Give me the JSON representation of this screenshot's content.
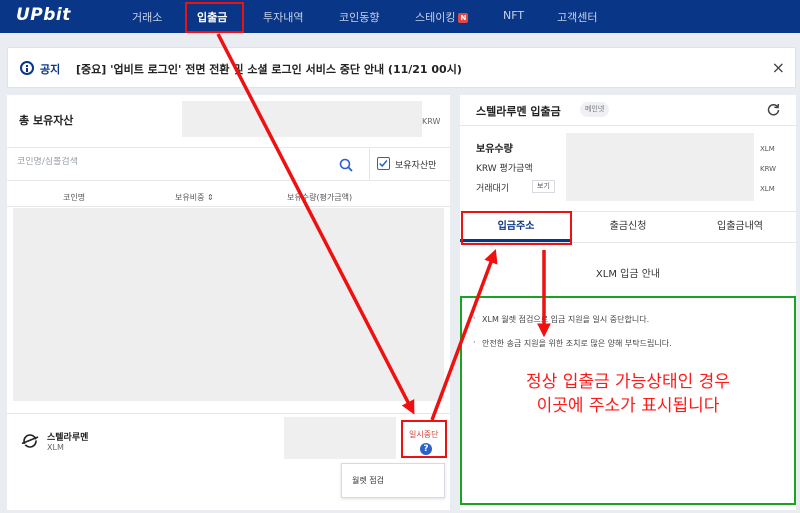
{
  "nav": {
    "logo": "UPbit",
    "items": [
      {
        "label": "거래소"
      },
      {
        "label": "입출금"
      },
      {
        "label": "투자내역"
      },
      {
        "label": "코인동향"
      },
      {
        "label": "스테이킹",
        "badge": "N"
      },
      {
        "label": "NFT"
      },
      {
        "label": "고객센터"
      }
    ],
    "active": "입출금"
  },
  "notice": {
    "label": "공지",
    "text": "[중요] '업비트 로그인' 전면 전환 및 소셜 로그인 서비스 중단 안내 (11/21 00시)",
    "close": "×"
  },
  "assets": {
    "total_label": "총 보유자산",
    "total_unit": "KRW",
    "search_placeholder": "코인명/심볼검색",
    "own_only_label": "보유자산만",
    "own_only_checked": true,
    "columns": [
      "코인명",
      "보유비중 ⇕",
      "보유수량(평가금액)"
    ],
    "coin": {
      "name": "스텔라루멘",
      "symbol": "XLM",
      "status": "일시중단",
      "help": "?",
      "tooltip": "월렛 점검"
    }
  },
  "detail": {
    "title": "스텔라루멘 입출금",
    "badge": "메인넷",
    "rows": [
      {
        "label": "보유수량",
        "unit": "XLM"
      },
      {
        "label": "KRW 평가금액",
        "unit": "KRW"
      },
      {
        "label": "거래대기",
        "button": "보기",
        "unit": "XLM"
      }
    ],
    "tabs": [
      "입금주소",
      "출금신청",
      "입출금내역"
    ],
    "active_tab": "입금주소",
    "guide_title": "XLM 입금 안내",
    "notes": [
      "XLM 월렛 점검으로 입금 지원을 일시 중단합니다.",
      "안전한 송금 지원을 위한 조치로 많은 양해 부탁드립니다."
    ]
  },
  "annotation": {
    "line1": "정상 입출금 가능상태인 경우",
    "line2": "이곳에 주소가 표시됩니다",
    "colors": {
      "red": "#ee1111",
      "green": "#1aa321"
    }
  }
}
